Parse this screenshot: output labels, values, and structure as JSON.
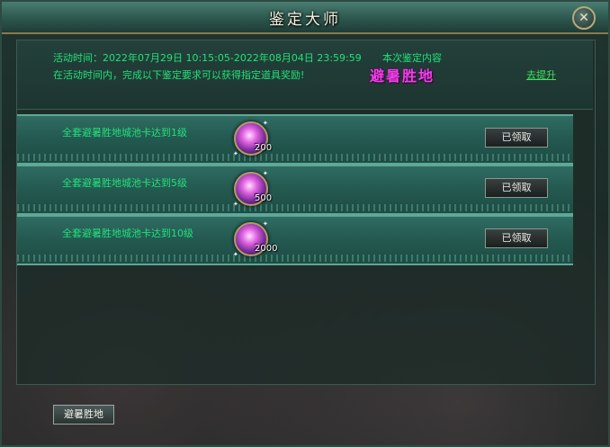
{
  "window": {
    "title": "鉴定大师",
    "close_glyph": "✕"
  },
  "info": {
    "activity_time": "活动时间：2022年07月29日 10:15:05-2022年08月04日 23:59:59",
    "content_label": "本次鉴定内容",
    "requirement_text": "在活动时间内，完成以下鉴定要求可以获得指定道具奖励!",
    "theme_name": "避暑胜地",
    "go_upgrade": "去提升"
  },
  "tasks": [
    {
      "label": "全套避暑胜地城池卡达到1级",
      "reward_count": "200",
      "button": "已领取"
    },
    {
      "label": "全套避暑胜地城池卡达到5级",
      "reward_count": "500",
      "button": "已领取"
    },
    {
      "label": "全套避暑胜地城池卡达到10级",
      "reward_count": "2000",
      "button": "已领取"
    }
  ],
  "footer": {
    "tab_button": "避暑胜地"
  },
  "icons": {
    "reward": "purple-orb-icon",
    "close": "close-icon"
  },
  "colors": {
    "task_text": "#22e07a",
    "theme_name": "#f040e8",
    "link": "#40e060"
  }
}
